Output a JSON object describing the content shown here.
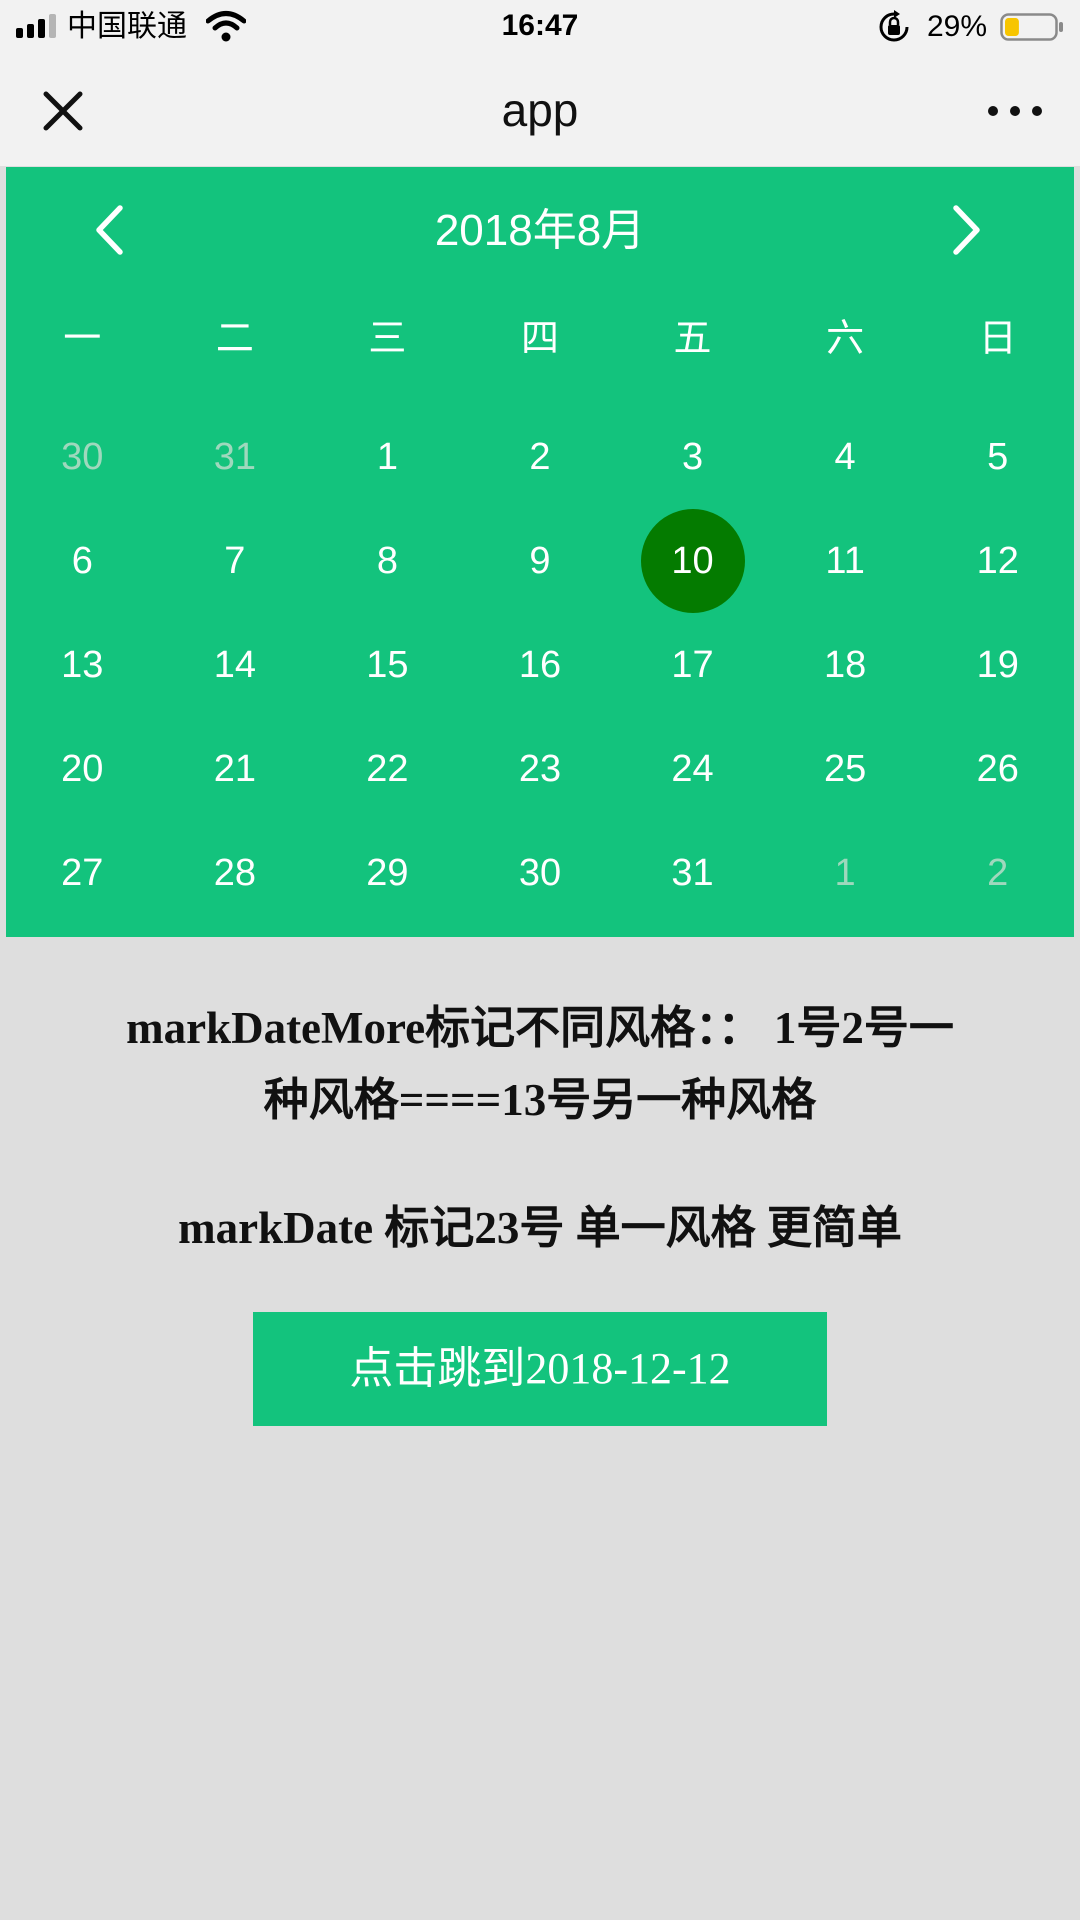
{
  "status_bar": {
    "carrier": "中国联通",
    "time": "16:47",
    "battery_percent": "29%",
    "battery_level": 0.29,
    "battery_color": "#f7c500"
  },
  "nav": {
    "title": "app",
    "close_icon": "close-icon",
    "more_icon": "more-dots-icon"
  },
  "calendar": {
    "month_title": "2018年8月",
    "prev_icon": "chevron-left-icon",
    "next_icon": "chevron-right-icon",
    "accent_color": "#13c37d",
    "selected_color": "#047b00",
    "weekdays": [
      "一",
      "二",
      "三",
      "四",
      "五",
      "六",
      "日"
    ],
    "days": [
      {
        "label": "30",
        "other": true
      },
      {
        "label": "31",
        "other": true
      },
      {
        "label": "1"
      },
      {
        "label": "2"
      },
      {
        "label": "3"
      },
      {
        "label": "4"
      },
      {
        "label": "5"
      },
      {
        "label": "6"
      },
      {
        "label": "7"
      },
      {
        "label": "8"
      },
      {
        "label": "9"
      },
      {
        "label": "10",
        "selected": true
      },
      {
        "label": "11"
      },
      {
        "label": "12"
      },
      {
        "label": "13"
      },
      {
        "label": "14"
      },
      {
        "label": "15"
      },
      {
        "label": "16"
      },
      {
        "label": "17"
      },
      {
        "label": "18"
      },
      {
        "label": "19"
      },
      {
        "label": "20"
      },
      {
        "label": "21"
      },
      {
        "label": "22"
      },
      {
        "label": "23"
      },
      {
        "label": "24"
      },
      {
        "label": "25"
      },
      {
        "label": "26"
      },
      {
        "label": "27"
      },
      {
        "label": "28"
      },
      {
        "label": "29"
      },
      {
        "label": "30"
      },
      {
        "label": "31"
      },
      {
        "label": "1",
        "other": true
      },
      {
        "label": "2",
        "other": true
      }
    ]
  },
  "content": {
    "desc_more_line1": "markDateMore标记不同风格：：  1号2号一",
    "desc_more_line2": "种风格====13号另一种风格",
    "desc_single": "markDate 标记23号 单一风格 更简单",
    "jump_button": "点击跳到2018-12-12"
  }
}
